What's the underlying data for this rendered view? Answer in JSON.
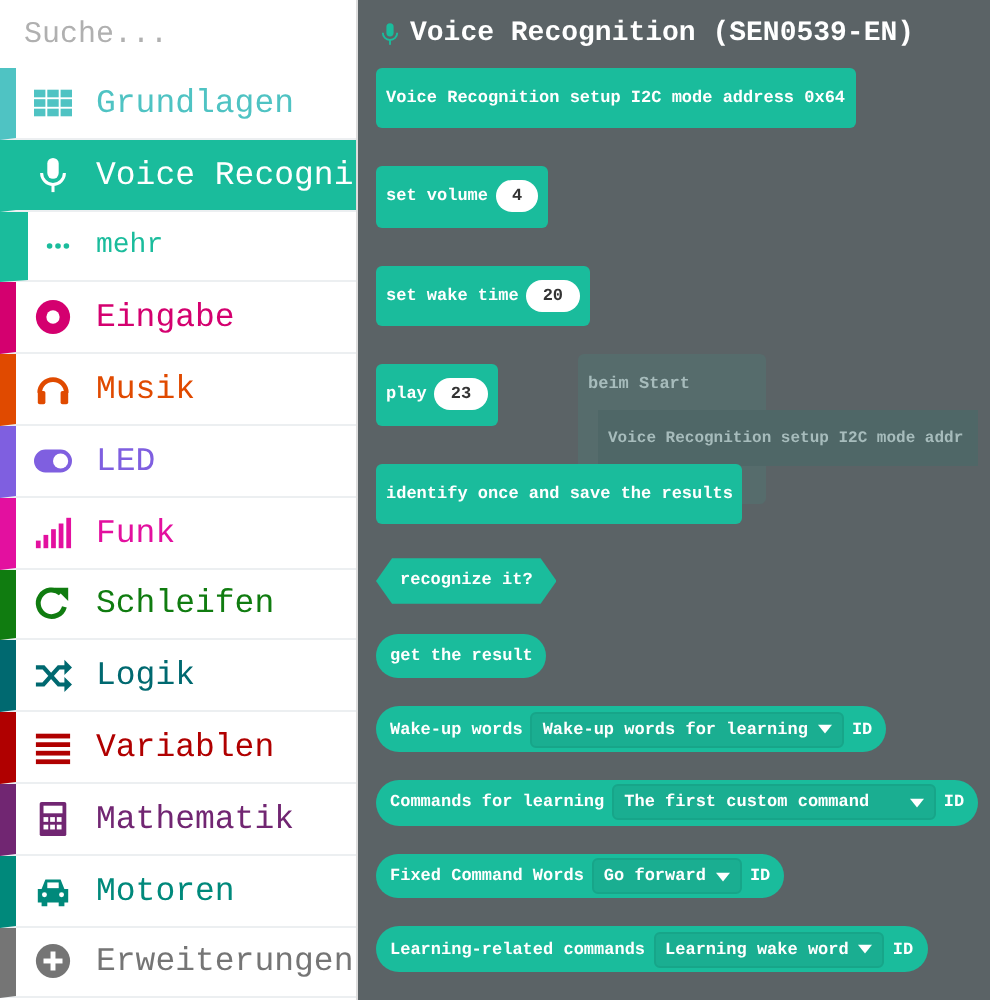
{
  "search": {
    "placeholder": "Suche..."
  },
  "categories": [
    {
      "kind": "category",
      "label": "Grundlagen",
      "color": "#4fc3c3",
      "selected": false
    },
    {
      "kind": "category",
      "label": "Voice Recogni",
      "color": "#1abc9c",
      "selected": true
    },
    {
      "kind": "sub",
      "label": "mehr",
      "color": "#1abc9c",
      "selected": false
    },
    {
      "kind": "category",
      "label": "Eingabe",
      "color": "#d4006f",
      "selected": false
    },
    {
      "kind": "category",
      "label": "Musik",
      "color": "#e04a00",
      "selected": false
    },
    {
      "kind": "category",
      "label": "LED",
      "color": "#7f5fe0",
      "selected": false
    },
    {
      "kind": "category",
      "label": "Funk",
      "color": "#e3109f",
      "selected": false
    },
    {
      "kind": "category",
      "label": "Schleifen",
      "color": "#107c10",
      "selected": false
    },
    {
      "kind": "category",
      "label": "Logik",
      "color": "#006970",
      "selected": false
    },
    {
      "kind": "category",
      "label": "Variablen",
      "color": "#b00000",
      "selected": false
    },
    {
      "kind": "category",
      "label": "Mathematik",
      "color": "#712672",
      "selected": false
    },
    {
      "kind": "category",
      "label": "Motoren",
      "color": "#00897b",
      "selected": false
    },
    {
      "kind": "category",
      "label": "Erweiterungen",
      "color": "#757575",
      "selected": false
    }
  ],
  "flyout": {
    "title": "Voice Recognition (SEN0539-EN)",
    "ghost": {
      "label": "beim Start",
      "inner": "Voice Recognition setup I2C mode addr"
    },
    "blocks": [
      {
        "kind": "statement",
        "label": "Voice Recognition setup I2C mode address 0x64"
      },
      {
        "kind": "statement",
        "label": "set volume",
        "number": "4"
      },
      {
        "kind": "statement",
        "label": "set wake time",
        "number": "20"
      },
      {
        "kind": "statement",
        "label": "play",
        "number": "23"
      },
      {
        "kind": "statement",
        "label": "identify once and save the results"
      },
      {
        "kind": "boolean",
        "label": "recognize it?"
      },
      {
        "kind": "reporter",
        "label": "get the result"
      },
      {
        "kind": "reporter",
        "label": "Wake-up words",
        "dropdown": "Wake-up words for learning",
        "suffix": "ID"
      },
      {
        "kind": "reporter",
        "label": "Commands for learning",
        "dropdown": "The first custom command   ",
        "suffix": "ID"
      },
      {
        "kind": "reporter",
        "label": "Fixed Command Words",
        "dropdown": "Go forward",
        "suffix": "ID"
      },
      {
        "kind": "reporter",
        "label": "Learning-related commands",
        "dropdown": "Learning wake word",
        "suffix": "ID"
      }
    ]
  }
}
